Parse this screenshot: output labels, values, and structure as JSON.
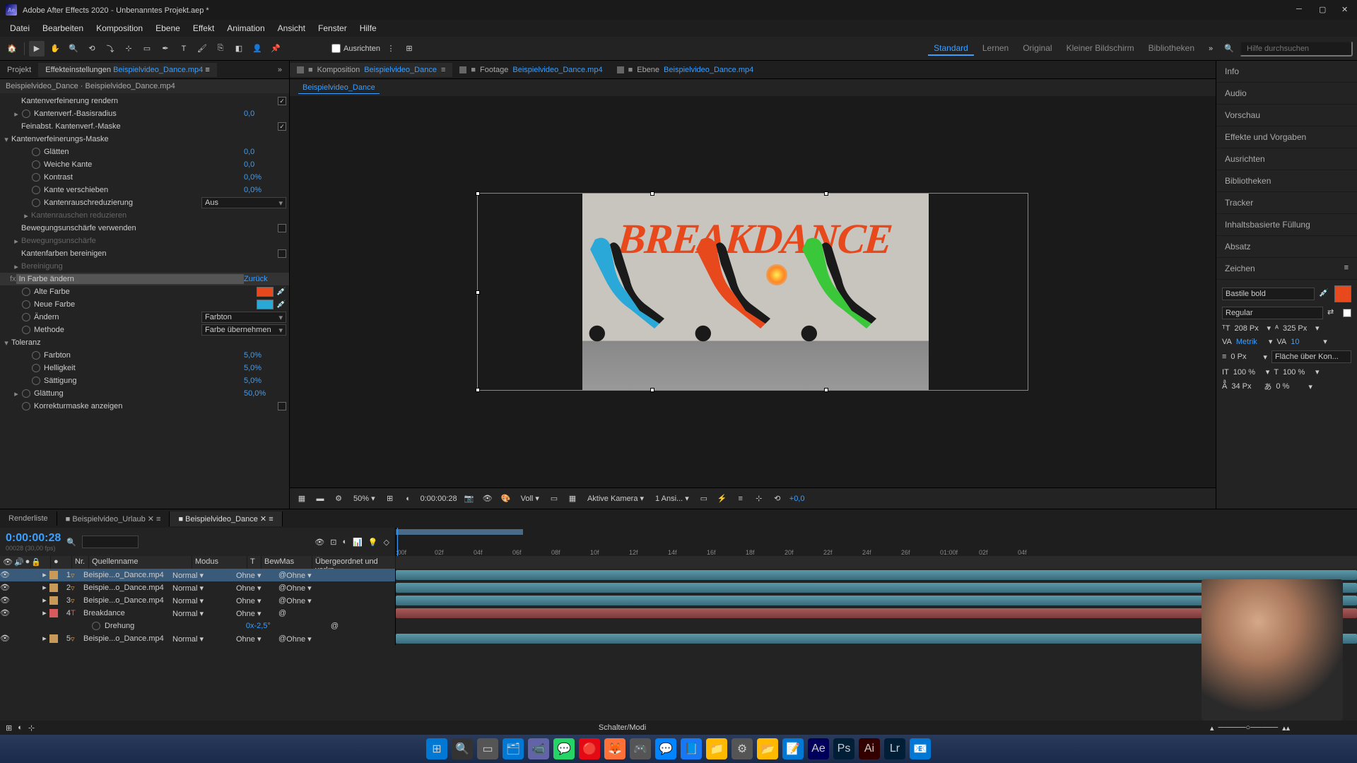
{
  "titlebar": {
    "app": "Adobe After Effects 2020",
    "project": "Unbenanntes Projekt.aep *"
  },
  "menus": [
    "Datei",
    "Bearbeiten",
    "Komposition",
    "Ebene",
    "Effekt",
    "Animation",
    "Ansicht",
    "Fenster",
    "Hilfe"
  ],
  "toolbar": {
    "align_label": "Ausrichten",
    "workspaces": [
      "Standard",
      "Lernen",
      "Original",
      "Kleiner Bildschirm",
      "Bibliotheken"
    ],
    "active_workspace": 0,
    "search_placeholder": "Hilfe durchsuchen"
  },
  "left_tabs": {
    "project": "Projekt",
    "effects": "Effekteinstellungen",
    "effects_target": "Beispielvideo_Dance.mp4"
  },
  "breadcrumb": "Beispielvideo_Dance · Beispielvideo_Dance.mp4",
  "effects": [
    {
      "indent": 1,
      "name": "Kantenverfeinerung rendern",
      "type": "check",
      "checked": true
    },
    {
      "indent": 1,
      "twirl": "▸",
      "stopwatch": true,
      "name": "Kantenverf.-Basisradius",
      "val": "0,0"
    },
    {
      "indent": 1,
      "name": "Feinabst. Kantenverf.-Maske",
      "type": "check",
      "checked": true
    },
    {
      "indent": 0,
      "twirl": "▾",
      "name": "Kantenverfeinerungs-Maske"
    },
    {
      "indent": 2,
      "stopwatch": true,
      "name": "Glätten",
      "val": "0,0"
    },
    {
      "indent": 2,
      "stopwatch": true,
      "name": "Weiche Kante",
      "val": "0,0"
    },
    {
      "indent": 2,
      "stopwatch": true,
      "name": "Kontrast",
      "val": "0,0%"
    },
    {
      "indent": 2,
      "stopwatch": true,
      "name": "Kante verschieben",
      "val": "0,0%"
    },
    {
      "indent": 2,
      "stopwatch": true,
      "name": "Kantenrauschreduzierung",
      "type": "drop",
      "val": "Aus"
    },
    {
      "indent": 2,
      "twirl": "▸",
      "name": "Kantenrauschen reduzieren",
      "dim": true
    },
    {
      "indent": 1,
      "name": "Bewegungsunschärfe verwenden",
      "type": "check",
      "checked": false
    },
    {
      "indent": 1,
      "twirl": "▸",
      "name": "Bewegungsunschärfe",
      "dim": true
    },
    {
      "indent": 1,
      "name": "Kantenfarben bereinigen",
      "type": "check",
      "checked": false
    },
    {
      "indent": 1,
      "twirl": "▸",
      "name": "Bereinigung",
      "dim": true
    },
    {
      "indent": 0,
      "fx": true,
      "name": "In Farbe ändern",
      "reset": "Zurück"
    },
    {
      "indent": 1,
      "stopwatch": true,
      "name": "Alte Farbe",
      "type": "color",
      "color": "#e8491c"
    },
    {
      "indent": 1,
      "stopwatch": true,
      "name": "Neue Farbe",
      "type": "color",
      "color": "#2aa8d8"
    },
    {
      "indent": 1,
      "stopwatch": true,
      "name": "Ändern",
      "type": "drop",
      "val": "Farbton"
    },
    {
      "indent": 1,
      "stopwatch": true,
      "name": "Methode",
      "type": "drop",
      "val": "Farbe übernehmen"
    },
    {
      "indent": 0,
      "twirl": "▾",
      "name": "Toleranz"
    },
    {
      "indent": 2,
      "stopwatch": true,
      "name": "Farbton",
      "val": "5,0%"
    },
    {
      "indent": 2,
      "stopwatch": true,
      "name": "Helligkeit",
      "val": "5,0%"
    },
    {
      "indent": 2,
      "stopwatch": true,
      "name": "Sättigung",
      "val": "5,0%"
    },
    {
      "indent": 1,
      "twirl": "▸",
      "stopwatch": true,
      "name": "Glättung",
      "val": "50,0%"
    },
    {
      "indent": 1,
      "stopwatch": true,
      "name": "Korrekturmaske anzeigen",
      "type": "check",
      "checked": false
    }
  ],
  "comp_tabs": [
    {
      "label": "Komposition",
      "sub": "Beispielvideo_Dance",
      "active": true
    },
    {
      "label": "Footage",
      "sub": "Beispielvideo_Dance.mp4"
    },
    {
      "label": "Ebene",
      "sub": "Beispielvideo_Dance.mp4"
    }
  ],
  "comp_breadcrumb": "Beispielvideo_Dance",
  "preview_text": "BREAKDANCE",
  "viewer": {
    "zoom": "50%",
    "timecode": "0:00:00:28",
    "resolution": "Voll",
    "camera": "Aktive Kamera",
    "views": "1 Ansi...",
    "exposure": "+0,0"
  },
  "right_items": [
    "Info",
    "Audio",
    "Vorschau",
    "Effekte und Vorgaben",
    "Ausrichten",
    "Bibliotheken",
    "Tracker",
    "Inhaltsbasierte Füllung",
    "Absatz",
    "Zeichen"
  ],
  "character": {
    "font": "Bastile bold",
    "style": "Regular",
    "fill": "#e8491c",
    "size": "208",
    "size_unit": "Px",
    "leading": "325",
    "leading_unit": "Px",
    "kerning": "Metrik",
    "tracking": "10",
    "stroke": "0",
    "stroke_unit": "Px",
    "stroke_mode": "Fläche über Kon...",
    "vscale": "100",
    "hscale": "100",
    "scale_unit": "%",
    "baseline": "34",
    "baseline_unit": "Px",
    "tsume": "0",
    "tsume_unit": "%"
  },
  "timeline": {
    "tabs": [
      "Renderliste",
      "Beispielvideo_Urlaub",
      "Beispielvideo_Dance"
    ],
    "active_tab": 2,
    "timecode": "0:00:00:28",
    "timecode_sub": "00028 (30,00 fps)",
    "cols": {
      "nr": "Nr.",
      "name": "Quellenname",
      "mode": "Modus",
      "t": "T",
      "trkmat": "BewMas",
      "parent": "Übergeordnet und verkn..."
    },
    "ticks": [
      ":00f",
      "02f",
      "04f",
      "06f",
      "08f",
      "10f",
      "12f",
      "14f",
      "16f",
      "18f",
      "20f",
      "22f",
      "24f",
      "26f",
      "01:00f",
      "02f",
      "04f"
    ],
    "layers": [
      {
        "nr": 1,
        "color": "#c89a5a",
        "icon": "▿",
        "name": "Beispie...o_Dance.mp4",
        "mode": "Normal",
        "trk": "Ohne",
        "parent": "Ohne",
        "selected": true
      },
      {
        "nr": 2,
        "color": "#c89a5a",
        "icon": "▿",
        "name": "Beispie...o_Dance.mp4",
        "mode": "Normal",
        "trk": "Ohne",
        "parent": "Ohne"
      },
      {
        "nr": 3,
        "color": "#c89a5a",
        "icon": "▿",
        "name": "Beispie...o_Dance.mp4",
        "mode": "Normal",
        "trk": "Ohne",
        "parent": "Ohne"
      },
      {
        "nr": 4,
        "color": "#d85a5a",
        "icon": "T",
        "name": "Breakdance",
        "mode": "Normal",
        "trk": "Ohne",
        "text": true,
        "child": {
          "name": "Drehung",
          "val": "0x-2,5°"
        }
      },
      {
        "nr": 5,
        "color": "#c89a5a",
        "icon": "▿",
        "name": "Beispie...o_Dance.mp4",
        "mode": "Normal",
        "trk": "Ohne",
        "parent": "Ohne"
      }
    ],
    "footer": "Schalter/Modi"
  },
  "taskbar_apps": [
    "⊞",
    "🔍",
    "▭",
    "🗂",
    "📹",
    "💬",
    "🔴",
    "🦊",
    "🎮",
    "💬",
    "📘",
    "📁",
    "⚙",
    "📂",
    "📝",
    "Ae",
    "Ps",
    "Ai",
    "Lr",
    "📧"
  ]
}
